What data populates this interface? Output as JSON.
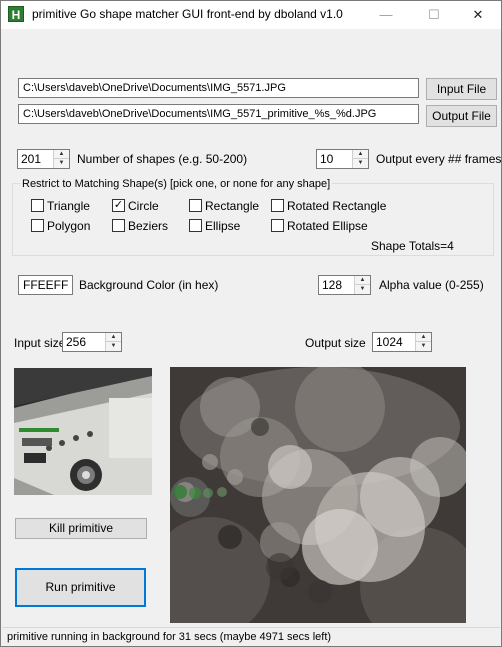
{
  "window": {
    "title": "primitive Go shape matcher GUI front-end by dboland v1.0",
    "icon_letter": "H"
  },
  "titlebar_buttons": {
    "minimize": "—",
    "maximize": "☐",
    "close": "✕"
  },
  "files": {
    "input_path": "C:\\Users\\daveb\\OneDrive\\Documents\\IMG_5571.JPG",
    "input_button": "Input File",
    "output_path": "C:\\Users\\daveb\\OneDrive\\Documents\\IMG_5571_primitive_%s_%d.JPG",
    "output_button": "Output File"
  },
  "shapes_count": {
    "value": "201",
    "label": "Number of shapes (e.g. 50-200)"
  },
  "output_every": {
    "value": "10",
    "label": "Output every ## frames"
  },
  "restrict_group": {
    "title": "Restrict to Matching Shape(s) [pick one, or none for any shape]",
    "options": [
      {
        "label": "Triangle",
        "checked": false
      },
      {
        "label": "Circle",
        "checked": true
      },
      {
        "label": "Rectangle",
        "checked": false
      },
      {
        "label": "Rotated Rectangle",
        "checked": false
      },
      {
        "label": "Polygon",
        "checked": false
      },
      {
        "label": "Beziers",
        "checked": false
      },
      {
        "label": "Ellipse",
        "checked": false
      },
      {
        "label": "Rotated Ellipse",
        "checked": false
      }
    ],
    "totals": "Shape Totals=4"
  },
  "background": {
    "value": "FFEEFF",
    "label": "Background Color (in hex)"
  },
  "alpha": {
    "value": "128",
    "label": "Alpha value (0-255)"
  },
  "input_size": {
    "label": "Input size",
    "value": "256"
  },
  "output_size": {
    "label": "Output size",
    "value": "1024"
  },
  "buttons": {
    "kill": "Kill primitive",
    "run": "Run primitive"
  },
  "status": "primitive running in background for 31 secs (maybe 4971 secs left)"
}
